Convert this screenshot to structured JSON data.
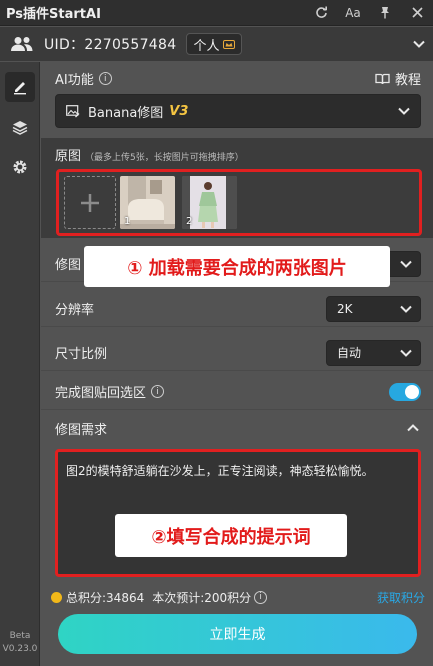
{
  "titlebar": {
    "title": "Ps插件StartAI",
    "font_btn": "Aa"
  },
  "user": {
    "uid": "UID：2270557484",
    "badge": "个人"
  },
  "sidebar": {
    "version_line1": "Beta",
    "version_line2": "V0.23.0"
  },
  "ai_function": {
    "label": "AI功能",
    "tutorial": "教程",
    "selected": "Banana修图",
    "version_tag": "V3"
  },
  "original": {
    "title": "原图",
    "hint": "（最多上传5张，长按图片可拖拽排序）",
    "thumbs": [
      "1",
      "2"
    ]
  },
  "callouts": {
    "first": "① 加载需要合成的两张图片",
    "second": "②填写合成的提示词"
  },
  "rows": {
    "retouch_label": "修图",
    "resolution_label": "分辨率",
    "resolution_value": "2K",
    "ratio_label": "尺寸比例",
    "ratio_value": "自动",
    "paste_back_label": "完成图贴回选区"
  },
  "requirement": {
    "title": "修图需求",
    "text": "图2的模特舒适躺在沙发上，正专注阅读，神态轻松愉悦。"
  },
  "points": {
    "total": "总积分:34864",
    "estimate": "本次预计:200积分",
    "get": "获取积分"
  },
  "generate_button": "立即生成",
  "colors": {
    "accent": "#27a8e0",
    "annotation_red": "#e12020",
    "v3_gold": "#f5c542",
    "coin": "#f2b819"
  }
}
